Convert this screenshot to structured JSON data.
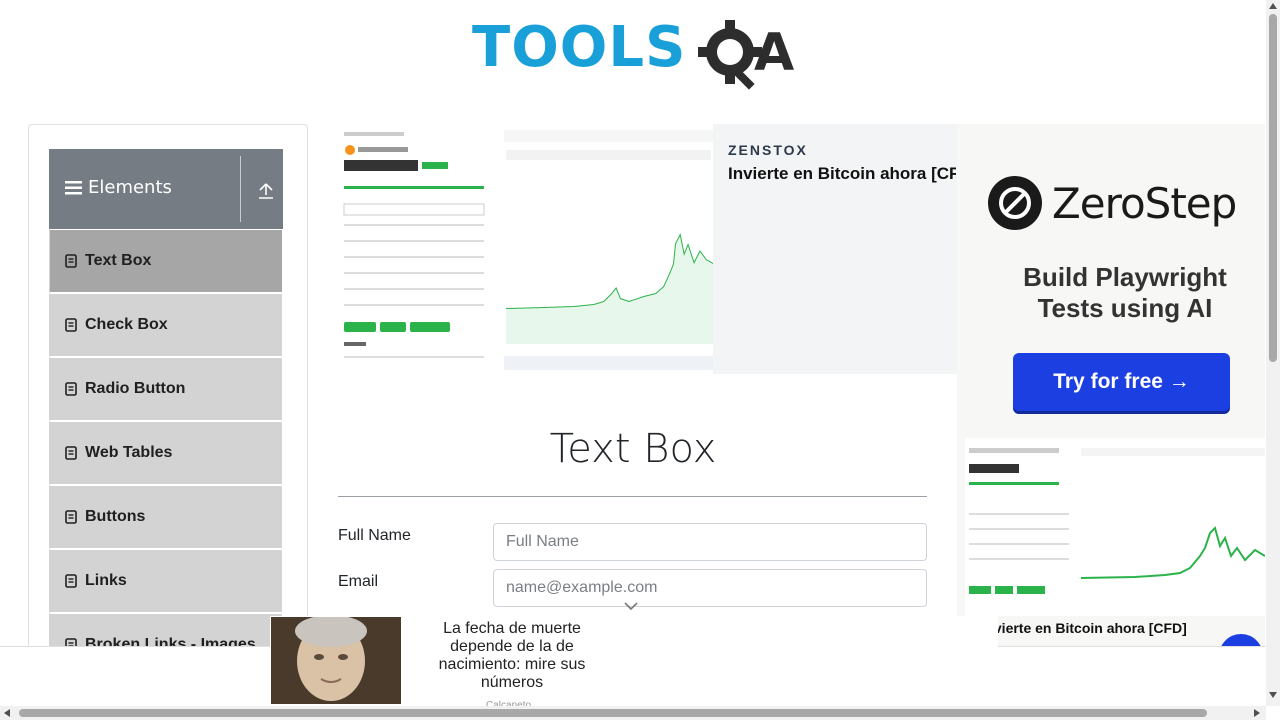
{
  "header": {
    "logo_text": "TOOLSQA"
  },
  "sidebar": {
    "group_title": "Elements",
    "items": [
      {
        "label": "Text Box"
      },
      {
        "label": "Check Box"
      },
      {
        "label": "Radio Button"
      },
      {
        "label": "Web Tables"
      },
      {
        "label": "Buttons"
      },
      {
        "label": "Links"
      },
      {
        "label": "Broken Links - Images"
      }
    ]
  },
  "ads": {
    "top_brand": "ZENSTOX",
    "top_headline": "Invierte en Bitcoin ahora [CFD]",
    "right_brand": "ZeroStep",
    "right_tagline": "Build Playwright Tests using AI",
    "right_button": "Try for free →",
    "right_caption": "ivierte en Bitcoin ahora [CFD]",
    "bottom_text": "La fecha de muerte depende de la de nacimiento: mire sus números",
    "bottom_sub": "Calcaneto"
  },
  "main": {
    "title": "Text Box",
    "fields": [
      {
        "label": "Full Name",
        "placeholder": "Full Name"
      },
      {
        "label": "Email",
        "placeholder": "name@example.com"
      }
    ]
  },
  "colors": {
    "brand_blue": "#1aa0d8",
    "sidebar_header": "#767c83",
    "active_item": "#a6a6a6",
    "cta_blue": "#1b3fe0"
  }
}
